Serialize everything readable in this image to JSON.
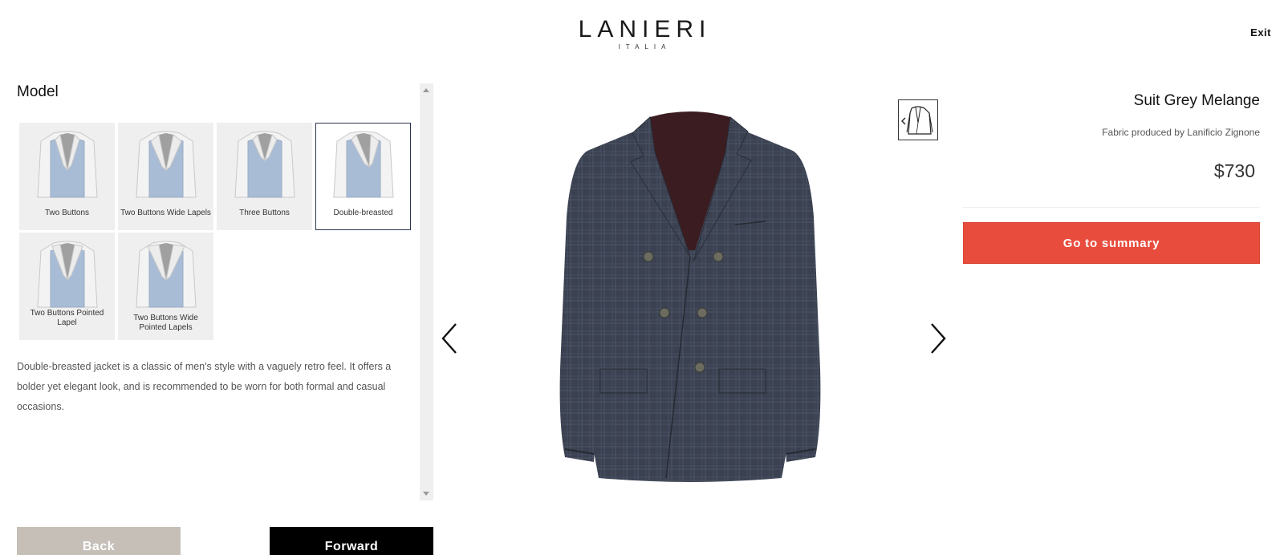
{
  "header": {
    "logo_main": "LANIERI",
    "logo_sub": "ITALIA",
    "exit_label": "Exit"
  },
  "left_panel": {
    "title": "Model",
    "options": [
      {
        "label": "Two Buttons",
        "selected": false
      },
      {
        "label": "Two Buttons Wide Lapels",
        "selected": false
      },
      {
        "label": "Three Buttons",
        "selected": false
      },
      {
        "label": "Double-breasted",
        "selected": true
      },
      {
        "label": "Two Buttons Pointed Lapel",
        "selected": false
      },
      {
        "label": "Two Buttons Wide Pointed Lapels",
        "selected": false
      }
    ],
    "description": "Double-breasted jacket is a classic of men's style with a vaguely retro feel. It offers a bolder yet elegant look, and is recommended to be worn for both formal and casual occasions."
  },
  "nav": {
    "back_label": "Back",
    "forward_label": "Forward"
  },
  "product": {
    "name": "Suit Grey Melange",
    "fabric": "Fabric produced by Lanificio Zignone",
    "price": "$730",
    "summary_label": "Go to summary"
  },
  "colors": {
    "accent": "#e84c3d",
    "back_button": "#c5bfb8",
    "forward_button": "#000000",
    "option_bg": "#efefef",
    "selected_border": "#2b3550"
  },
  "icons": [
    "chevron-left-icon",
    "chevron-right-icon",
    "jacket-view-icon",
    "scroll-up-icon",
    "scroll-down-icon"
  ]
}
